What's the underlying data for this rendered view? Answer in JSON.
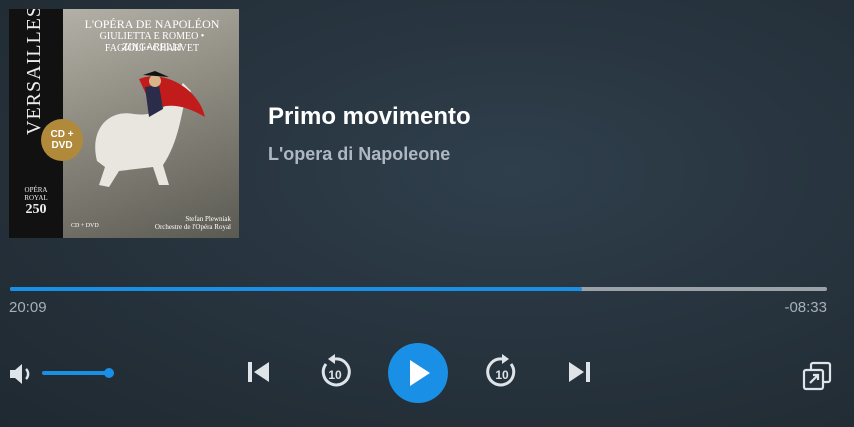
{
  "cover": {
    "band_text": "VERSAILLES",
    "seal_text": "CD + DVD",
    "anniversary_top": "OPÉRA ROYAL",
    "anniversary_num": "250",
    "line1": "L'OPÉRA DE NAPOLÉON",
    "line2": "GIULIETTA E ROMEO • ZINGARELLI",
    "line3": "FAGIOLI • CHARVET",
    "credit1": "Stefan Plewniak",
    "credit2": "Orchestre de l'Opéra Royal",
    "format": "CD + DVD"
  },
  "track": {
    "title": "Primo movimento",
    "album": "L'opera di Napoleone"
  },
  "playback": {
    "elapsed": "20:09",
    "remaining": "-08:33",
    "progress_fraction": 0.7,
    "volume_fraction": 1.0
  },
  "colors": {
    "accent": "#1a8fe6",
    "track_gray": "#9aa2a8"
  },
  "icons": {
    "volume": "volume-icon",
    "previous": "skip-previous-icon",
    "rewind": "rewind-10-icon",
    "play": "play-icon",
    "forward": "forward-10-icon",
    "next": "skip-next-icon",
    "popout": "popout-icon"
  }
}
